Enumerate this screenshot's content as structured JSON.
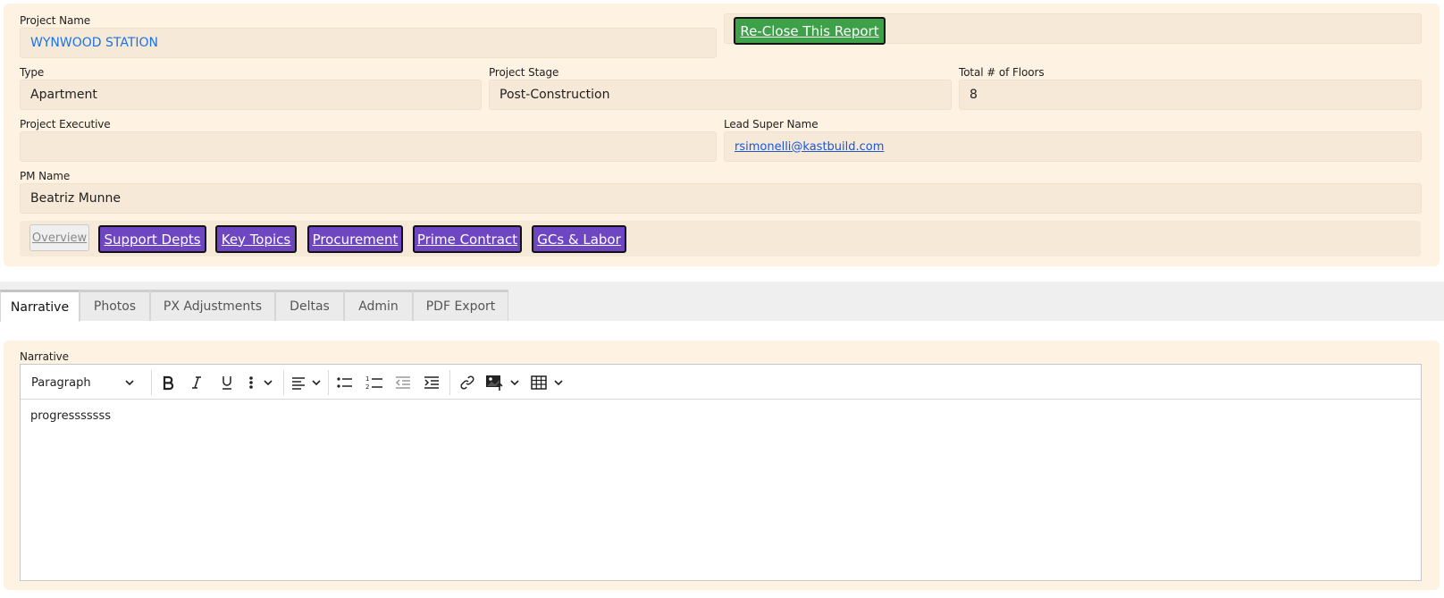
{
  "project": {
    "name_label": "Project Name",
    "name_value": "WYNWOOD STATION",
    "reclose_label": "Re-Close This Report",
    "type_label": "Type",
    "type_value": "Apartment",
    "stage_label": "Project Stage",
    "stage_value": "Post-Construction",
    "floors_label": "Total # of Floors",
    "floors_value": "8",
    "exec_label": "Project Executive",
    "exec_value": "",
    "lead_label": "Lead Super Name",
    "lead_value": "rsimonelli@kastbuild.com",
    "pm_label": "PM Name",
    "pm_value": "Beatriz Munne"
  },
  "nav": {
    "overview": "Overview",
    "support": "Support Depts",
    "key_topics": "Key Topics",
    "procurement": "Procurement",
    "prime_contract": "Prime Contract",
    "gcs_labor": "GCs & Labor"
  },
  "tabs": [
    "Narrative",
    "Photos",
    "PX Adjustments",
    "Deltas",
    "Admin",
    "PDF Export"
  ],
  "narrative": {
    "label": "Narrative",
    "format_select": "Paragraph",
    "content": "progresssssss"
  },
  "colors": {
    "panel_bg": "#fef2e2",
    "field_bg": "#f6e9d8",
    "reclose_green": "#3ea14a",
    "nav_purple": "#6f46c2"
  }
}
